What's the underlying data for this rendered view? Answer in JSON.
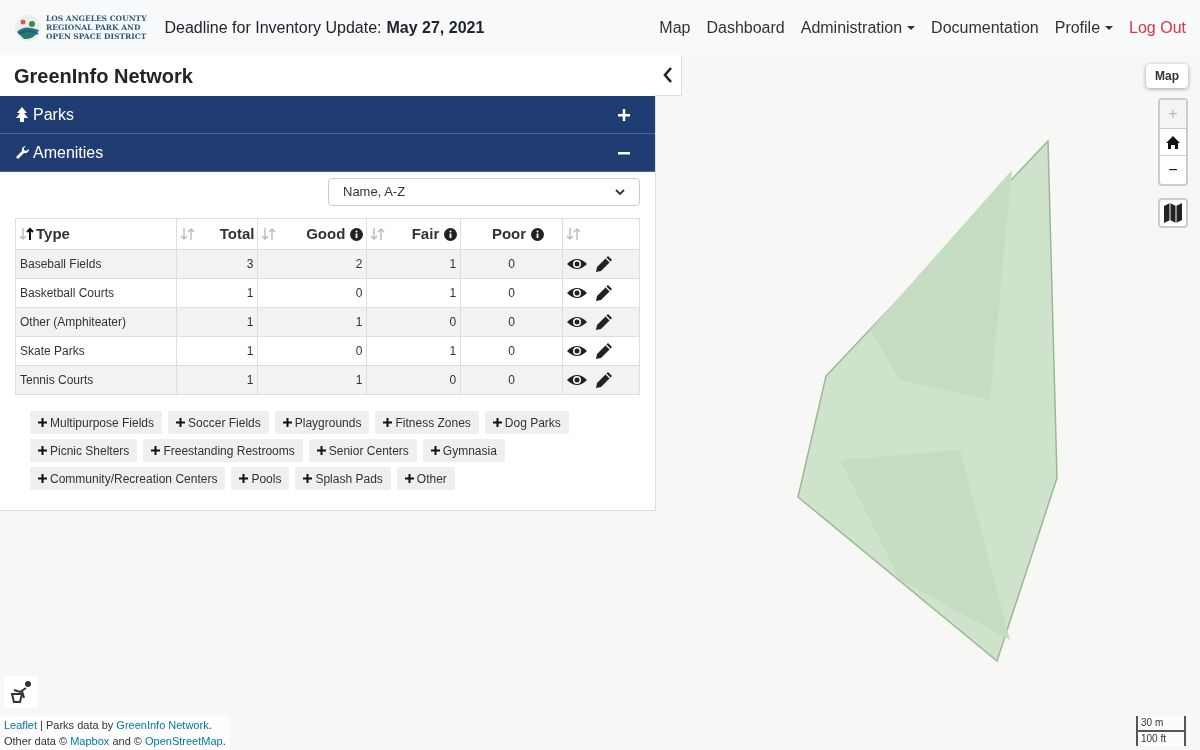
{
  "header": {
    "logo_lines": [
      "LOS ANGELES COUNTY",
      "REGIONAL PARK AND",
      "OPEN SPACE DISTRICT"
    ],
    "deadline_label": "Deadline for Inventory Update:",
    "deadline_date": "May 27, 2021",
    "nav": [
      {
        "label": "Map",
        "kind": "link"
      },
      {
        "label": "Dashboard",
        "kind": "link"
      },
      {
        "label": "Administration",
        "kind": "dropdown"
      },
      {
        "label": "Documentation",
        "kind": "link"
      },
      {
        "label": "Profile",
        "kind": "dropdown"
      },
      {
        "label": "Log Out",
        "kind": "logout"
      }
    ]
  },
  "panel": {
    "title": "GreenInfo Network",
    "sections": [
      {
        "label": "Parks",
        "kind": "tree",
        "expanded": false
      },
      {
        "label": "Amenities",
        "kind": "wrench",
        "expanded": true
      }
    ],
    "sort_select": "Name, A-Z",
    "columns": [
      {
        "label": "Type",
        "sortable": true,
        "sorted": true,
        "info": false
      },
      {
        "label": "Total",
        "sortable": true,
        "sorted": false,
        "info": false
      },
      {
        "label": "Good",
        "sortable": true,
        "sorted": false,
        "info": true
      },
      {
        "label": "Fair",
        "sortable": true,
        "sorted": false,
        "info": true
      },
      {
        "label": "Poor",
        "sortable": false,
        "info": true
      },
      {
        "sortable": true,
        "sorted": false,
        "info": false
      }
    ],
    "rows": [
      {
        "type": "Baseball Fields",
        "total": "3",
        "good": "2",
        "fair": "1",
        "poor": "0"
      },
      {
        "type": "Basketball Courts",
        "total": "1",
        "good": "0",
        "fair": "1",
        "poor": "0"
      },
      {
        "type": "Other (Amphiteater)",
        "total": "1",
        "good": "1",
        "fair": "0",
        "poor": "0"
      },
      {
        "type": "Skate Parks",
        "total": "1",
        "good": "0",
        "fair": "1",
        "poor": "0"
      },
      {
        "type": "Tennis Courts",
        "total": "1",
        "good": "1",
        "fair": "0",
        "poor": "0"
      }
    ],
    "add_buttons": [
      "Multipurpose Fields",
      "Soccer Fields",
      "Playgrounds",
      "Fitness Zones",
      "Dog Parks",
      "Picnic Shelters",
      "Freestanding Restrooms",
      "Senior Centers",
      "Gymnasia",
      "Community/Recreation Centers",
      "Pools",
      "Splash Pads",
      "Other"
    ]
  },
  "map": {
    "layer_button": "Map",
    "zoom_in": {
      "label": "+",
      "disabled": true
    },
    "zoom_out": {
      "label": "−",
      "disabled": false
    },
    "attribution": [
      [
        {
          "text": "Leaflet",
          "link": true
        },
        {
          "text": " | Parks data by ",
          "link": false
        },
        {
          "text": "GreenInfo Network",
          "link": true
        },
        {
          "text": ".",
          "link": false
        }
      ],
      [
        {
          "text": "Other data © ",
          "link": false
        },
        {
          "text": "Mapbox",
          "link": true
        },
        {
          "text": " and © ",
          "link": false
        },
        {
          "text": "OpenStreetMap",
          "link": true
        },
        {
          "text": ".",
          "link": false
        }
      ]
    ],
    "scale": [
      "30 m",
      "100 ft"
    ]
  }
}
